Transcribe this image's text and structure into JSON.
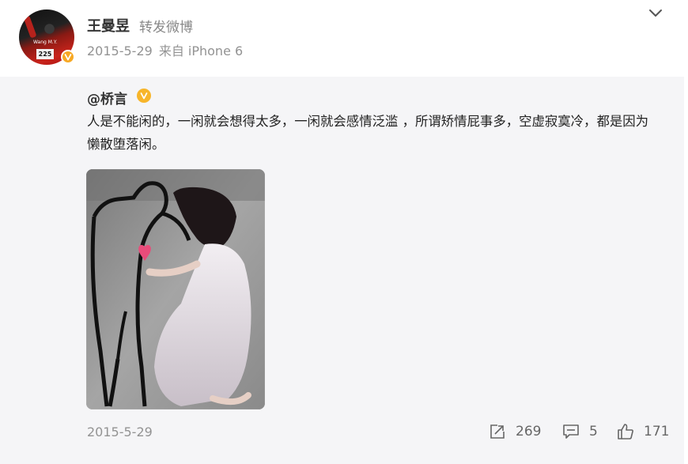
{
  "post": {
    "username": "王曼昱",
    "action": "转发微博",
    "date": "2015-5-29",
    "source": "来自 iPhone 6",
    "avatar_bib": "225",
    "avatar_shirt": "Wang M.Y."
  },
  "retweet": {
    "author": "@桥言",
    "text": "人是不能闲的，一闲就会想得太多，一闲就会感情泛滥 ，所谓矫情屁事多，空虚寂寞冷，都是因为懒散堕落闲。",
    "date": "2015-5-29",
    "stats": {
      "reposts": "269",
      "comments": "5",
      "likes": "171"
    }
  },
  "icons": {
    "verified": "verified-badge-icon",
    "more": "chevron-down-icon",
    "repost": "repost-icon",
    "comment": "comment-icon",
    "like": "like-icon"
  },
  "colors": {
    "verified": "#f7a823",
    "card_bg": "#f5f5f7",
    "muted_text": "#939393"
  }
}
